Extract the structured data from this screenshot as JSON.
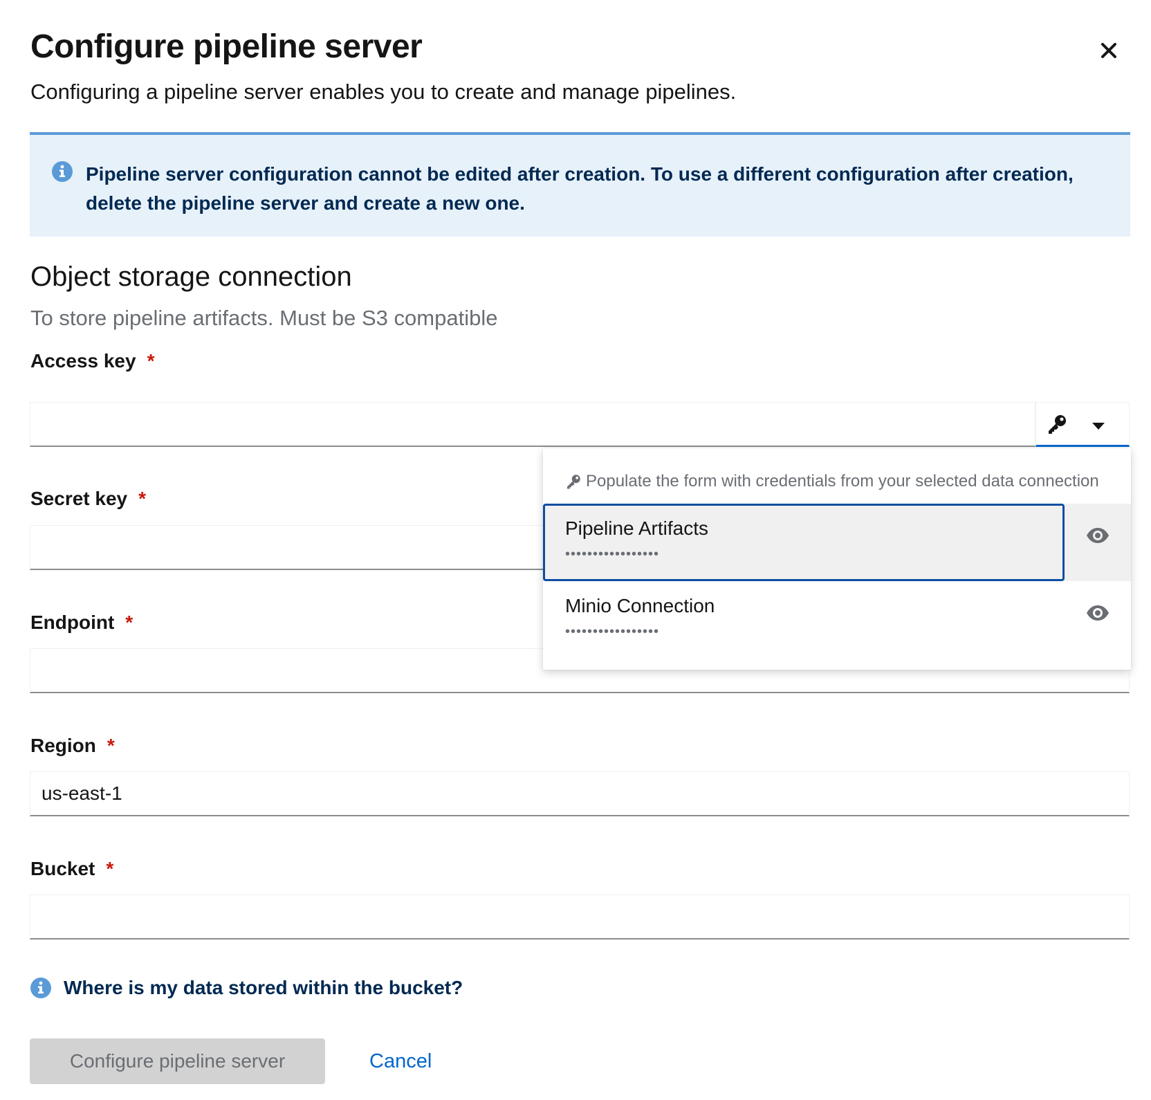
{
  "modal": {
    "title": "Configure pipeline server",
    "description": "Configuring a pipeline server enables you to create and manage pipelines."
  },
  "alert": {
    "message": "Pipeline server configuration cannot be edited after creation. To use a different configuration after creation, delete the pipeline server and create a new one."
  },
  "section": {
    "title": "Object storage connection",
    "subtitle": "To store pipeline artifacts. Must be S3 compatible"
  },
  "fields": {
    "access_key": {
      "label": "Access key",
      "required": "*",
      "value": ""
    },
    "secret_key": {
      "label": "Secret key",
      "required": "*",
      "value": ""
    },
    "endpoint": {
      "label": "Endpoint",
      "required": "*",
      "value": ""
    },
    "region": {
      "label": "Region",
      "required": "*",
      "value": "us-east-1"
    },
    "bucket": {
      "label": "Bucket",
      "required": "*",
      "value": ""
    }
  },
  "credentials_menu": {
    "description": "Populate the form with credentials from your selected data connection",
    "items": [
      {
        "name": "Pipeline Artifacts",
        "masked": "•••••••••••••••••"
      },
      {
        "name": "Minio Connection",
        "masked": "•••••••••••••••••"
      }
    ]
  },
  "help": {
    "text": "Where is my data stored within the bucket?"
  },
  "actions": {
    "submit": "Configure pipeline server",
    "cancel": "Cancel"
  },
  "colors": {
    "info_blue": "#5a9bd7",
    "alert_bg": "#e7f1fa",
    "required_red": "#c9190b",
    "link_blue": "#0066cc",
    "focus_blue": "#0b4ea2"
  },
  "icons": {
    "close": "close-icon",
    "info": "info-circle-icon",
    "key": "key-icon",
    "caret": "caret-down-icon",
    "eye": "eye-icon"
  }
}
